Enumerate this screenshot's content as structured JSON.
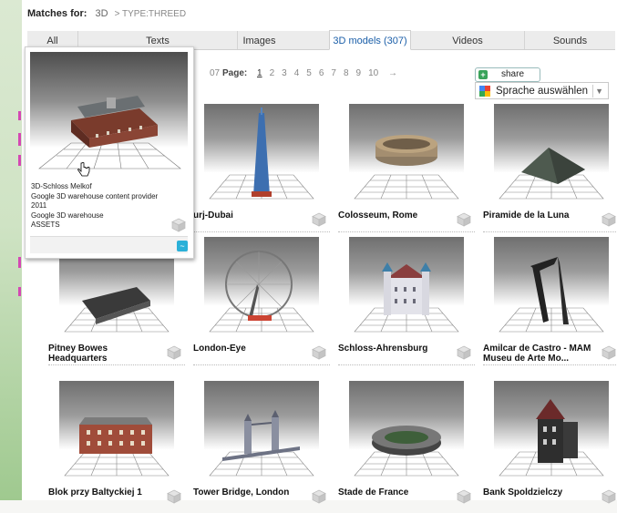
{
  "header": {
    "matches_label": "Matches for:",
    "query": "3D",
    "type_filter": "> TYPE:THREED"
  },
  "tabs": [
    {
      "label": "All",
      "active": false
    },
    {
      "label": "Texts",
      "active": false
    },
    {
      "label": "Images",
      "active": false
    },
    {
      "label": "3D models (307)",
      "active": true
    },
    {
      "label": "Videos",
      "active": false
    },
    {
      "label": "Sounds",
      "active": false
    }
  ],
  "pagination": {
    "prefix": "07",
    "label": "Page:",
    "current": "1",
    "pages": [
      "1",
      "2",
      "3",
      "4",
      "5",
      "6",
      "7",
      "8",
      "9",
      "10"
    ],
    "next_arrow": "→"
  },
  "share": {
    "label": "share",
    "icon": "plus-icon"
  },
  "translate": {
    "label": "Sprache auswählen",
    "arrow": "▼",
    "icon": "google-translate-icon"
  },
  "results": [
    {
      "title": "urj-Dubai",
      "model": "tower"
    },
    {
      "title": "Colosseum, Rome",
      "model": "colosseum"
    },
    {
      "title": "Piramide de la Luna",
      "model": "pyramid"
    },
    {
      "title": "Pitney Bowes Headquarters",
      "model": "hq"
    },
    {
      "title": "London-Eye",
      "model": "wheel"
    },
    {
      "title": "Schloss-Ahrensburg",
      "model": "castle"
    },
    {
      "title": "Amilcar de Castro - MAM Museu de Arte Mo...",
      "model": "sculpture"
    },
    {
      "title": "Blok przy Baltyckiej 1",
      "model": "block"
    },
    {
      "title": "Tower Bridge, London",
      "model": "bridge"
    },
    {
      "title": "Stade de France",
      "model": "stadium"
    },
    {
      "title": "Bank Spoldzielczy",
      "model": "bank"
    }
  ],
  "popup": {
    "title": "3D-Schloss Melkof",
    "line1": "Google 3D warehouse content provider",
    "line2": "2011",
    "line3": "Google 3D warehouse",
    "line4": "ASSETS",
    "button_icon": "tilde-icon"
  },
  "colors": {
    "active_tab_text": "#1a5ea8",
    "popup_button": "#2ab0d8",
    "share_icon": "#3aa35a"
  }
}
